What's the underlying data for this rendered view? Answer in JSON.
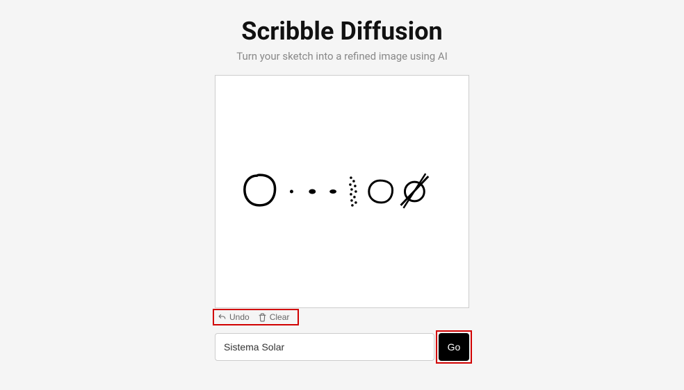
{
  "header": {
    "title": "Scribble Diffusion",
    "subtitle": "Turn your sketch into a refined image using AI"
  },
  "toolbar": {
    "undo_label": "Undo",
    "clear_label": "Clear"
  },
  "prompt": {
    "value": "Sistema Solar",
    "go_label": "Go"
  }
}
